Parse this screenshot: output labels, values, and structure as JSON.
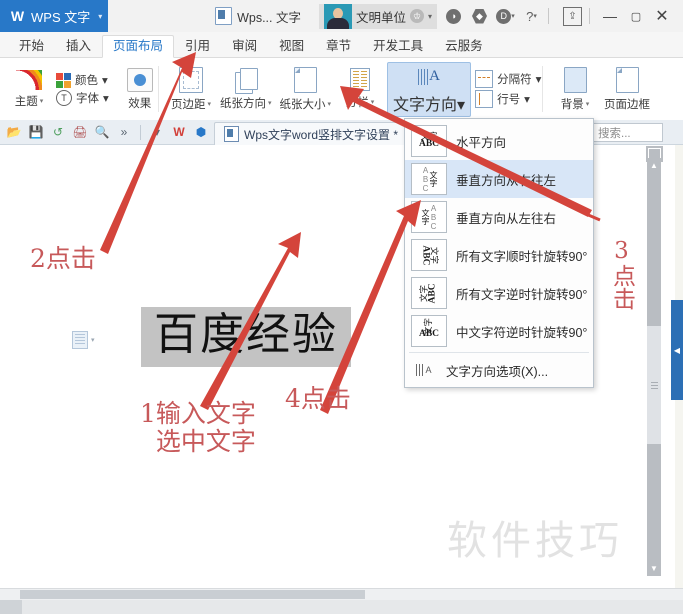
{
  "titlebar": {
    "app_tab": "WPS 文字",
    "app_caret": "▾",
    "doc_chip": "Wps... 文字",
    "account_name": "文明单位",
    "badge_icon": "crown-icon",
    "icons": [
      "compass-icon",
      "hexagon-icon",
      "droplet-icon",
      "help-icon",
      "share-icon"
    ],
    "help_label": "?",
    "minimize": "—",
    "maximize": "▢",
    "close": "✕"
  },
  "ribbon_tabs": [
    {
      "label": "开始",
      "active": false
    },
    {
      "label": "插入",
      "active": false
    },
    {
      "label": "页面布局",
      "active": true
    },
    {
      "label": "引用",
      "active": false
    },
    {
      "label": "审阅",
      "active": false
    },
    {
      "label": "视图",
      "active": false
    },
    {
      "label": "章节",
      "active": false
    },
    {
      "label": "开发工具",
      "active": false
    },
    {
      "label": "云服务",
      "active": false
    }
  ],
  "ribbon": {
    "theme": "主题",
    "colors": "颜色",
    "fonts": "字体",
    "effects": "效果",
    "margins": "页边距",
    "orientation": "纸张方向",
    "size": "纸张大小",
    "columns": "分栏",
    "text_direction": "文字方向",
    "separator": "分隔符",
    "line_number": "行号",
    "background": "背景",
    "page_border": "页面边框",
    "caret": "▾"
  },
  "quickbar": {
    "icons": [
      "open-icon",
      "save-icon",
      "undo-icon",
      "print-icon",
      "print-preview-icon",
      "more-icon",
      "dropdown-icon",
      "wps-icon",
      "cube-icon"
    ],
    "doc_tab": "Wps文字word竖排文字设置 *",
    "search_placeholder": "找命令、搜索..."
  },
  "document": {
    "selected_text": "百度经验",
    "watermark": "软件技巧"
  },
  "menu": {
    "items": [
      {
        "label": "水平方向",
        "icon": "text-horizontal-icon",
        "highlighted": false
      },
      {
        "label": "垂直方向从右往左",
        "icon": "text-vertical-rtl-icon",
        "highlighted": true
      },
      {
        "label": "垂直方向从左往右",
        "icon": "text-vertical-ltr-icon",
        "highlighted": false
      },
      {
        "label": "所有文字顺时针旋转90°",
        "icon": "rotate-all-cw-icon",
        "highlighted": false
      },
      {
        "label": "所有文字逆时针旋转90°",
        "icon": "rotate-all-ccw-icon",
        "highlighted": false
      },
      {
        "label": "中文字符逆时针旋转90°",
        "icon": "rotate-cjk-ccw-icon",
        "highlighted": false
      }
    ],
    "options_item": "文字方向选项(X)...",
    "tile_cn": "文字",
    "tile_ab": "ABC"
  },
  "annotations": [
    {
      "id": "step2",
      "text": "2点击"
    },
    {
      "id": "step1",
      "text": "1输入文字\n  选中文字"
    },
    {
      "id": "step4",
      "text": "4点击"
    },
    {
      "id": "step3",
      "text": "3点击"
    }
  ],
  "colors": {
    "accent": "#2878c8",
    "annotation": "#c7595a",
    "selection": "#c3c3c3",
    "menu_highlight": "#d8e6f7",
    "panel_blue": "#2c6fb5"
  }
}
